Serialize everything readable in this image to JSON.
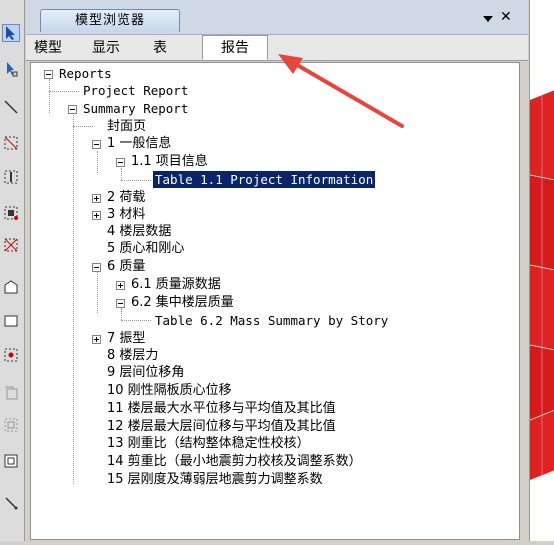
{
  "panel": {
    "title": "模型浏览器",
    "pin_icon": "pin-dropdown-icon",
    "close_icon": "close-icon",
    "close_glyph": "✕"
  },
  "tabs": [
    {
      "label": "模型",
      "active": false
    },
    {
      "label": "显示",
      "active": false
    },
    {
      "label": "表",
      "active": false
    },
    {
      "label": "报告",
      "active": true
    }
  ],
  "tree": {
    "reports": "Reports",
    "project_report": "Project Report",
    "summary_report": "Summary Report",
    "cover": "封面页",
    "general": "1 一般信息",
    "project_info": "1.1 项目信息",
    "table_1_1": "Table 1.1 Project Information",
    "loads": "2 荷载",
    "materials": "3 材料",
    "story_data": "4 楼层数据",
    "mass_center": "5 质心和刚心",
    "mass": "6 质量",
    "mass_source": "6.1 质量源数据",
    "story_mass": "6.2 集中楼层质量",
    "table_6_2": "Table 6.2 Mass Summary by Story",
    "modes": "7 振型",
    "story_force": "8 楼层力",
    "drift": "9 层间位移角",
    "diaphragm_disp": "10 刚性隔板质心位移",
    "max_disp_ratio": "11 楼层最大水平位移与平均值及其比值",
    "max_drift_ratio": "12 楼层最大层间位移与平均值及其比值",
    "stiffness_ratio": "13 刚重比（结构整体稳定性校核）",
    "shear_ratio": "14 剪重比（最小地震剪力校核及调整系数）",
    "weak_story": "15 层刚度及薄弱层地震剪力调整系数"
  },
  "colors": {
    "selection": "#0a246a",
    "annotation_arrow": "#e8463c",
    "model_red": "#e0211d"
  },
  "toolbar_icons": [
    "pointer-icon",
    "select-icon",
    "line-icon",
    "diagonal-icon",
    "column-icon",
    "grid-icon",
    "cross-icon",
    "polygon-icon",
    "rectangle-icon",
    "point-icon",
    "copy-icon",
    "dotted-rect-icon",
    "box-icon",
    "pen-icon"
  ]
}
